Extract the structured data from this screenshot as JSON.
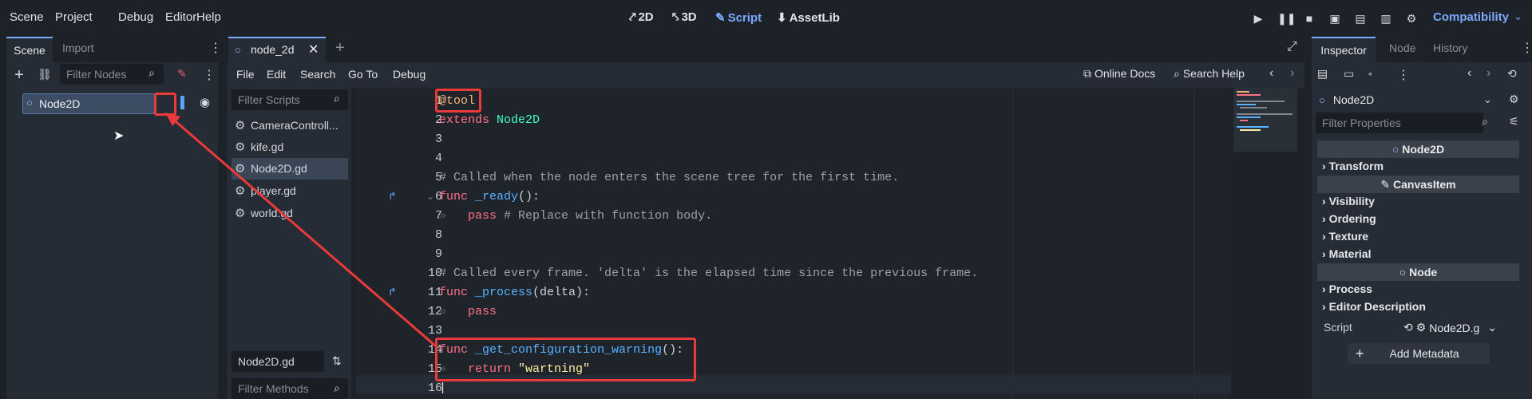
{
  "menu": [
    "Scene",
    "Project",
    "Debug",
    "Editor",
    "Help"
  ],
  "workspaces": [
    {
      "label": "2D",
      "icon": "2d-icon",
      "active": false
    },
    {
      "label": "3D",
      "icon": "3d-icon",
      "active": false
    },
    {
      "label": "Script",
      "icon": "script-icon",
      "active": true
    },
    {
      "label": "AssetLib",
      "icon": "assetlib-icon",
      "active": false
    }
  ],
  "renderer": "Compatibility",
  "scene_dock": {
    "tabs": [
      "Scene",
      "Import"
    ],
    "filter_placeholder": "Filter Nodes",
    "root_node": "Node2D"
  },
  "editor_tabs": {
    "open_tab": "node_2d"
  },
  "script_menu": [
    "File",
    "Edit",
    "Search",
    "Go To",
    "Debug"
  ],
  "script_toolbar": {
    "online_docs": "Online Docs",
    "search_help": "Search Help"
  },
  "script_list": {
    "filter_placeholder": "Filter Scripts",
    "items": [
      "CameraControll...",
      "kife.gd",
      "Node2D.gd",
      "player.gd",
      "world.gd"
    ],
    "current": "Node2D.gd",
    "filter_methods_placeholder": "Filter Methods"
  },
  "code_lines": [
    {
      "n": "1",
      "text": "@tool"
    },
    {
      "n": "2",
      "text": "extends Node2D"
    },
    {
      "n": "3",
      "text": ""
    },
    {
      "n": "4",
      "text": ""
    },
    {
      "n": "5",
      "text": "# Called when the node enters the scene tree for the first time."
    },
    {
      "n": "6",
      "text": "func _ready():"
    },
    {
      "n": "7",
      "text": "pass # Replace with function body."
    },
    {
      "n": "8",
      "text": ""
    },
    {
      "n": "9",
      "text": ""
    },
    {
      "n": "10",
      "text": "# Called every frame. 'delta' is the elapsed time since the previous frame."
    },
    {
      "n": "11",
      "text": "func _process(delta):"
    },
    {
      "n": "12",
      "text": "pass"
    },
    {
      "n": "13",
      "text": ""
    },
    {
      "n": "14",
      "text": "func _get_configuration_warning():"
    },
    {
      "n": "15",
      "text": "return \"wartning\""
    },
    {
      "n": "16",
      "text": ""
    }
  ],
  "inspector": {
    "tabs": [
      "Inspector",
      "Node",
      "History"
    ],
    "object": "Node2D",
    "filter_placeholder": "Filter Properties",
    "sections": [
      {
        "title": "Node2D",
        "groups": [
          "Transform"
        ]
      },
      {
        "title": "CanvasItem",
        "groups": [
          "Visibility",
          "Ordering",
          "Texture",
          "Material"
        ]
      },
      {
        "title": "Node",
        "groups": [
          "Process",
          "Editor Description"
        ]
      }
    ],
    "script_label": "Script",
    "script_value": "Node2D.g",
    "add_metadata": "Add Metadata"
  },
  "colors": {
    "accent": "#7aa9ff",
    "highlight_box": "#ea3a3a"
  }
}
